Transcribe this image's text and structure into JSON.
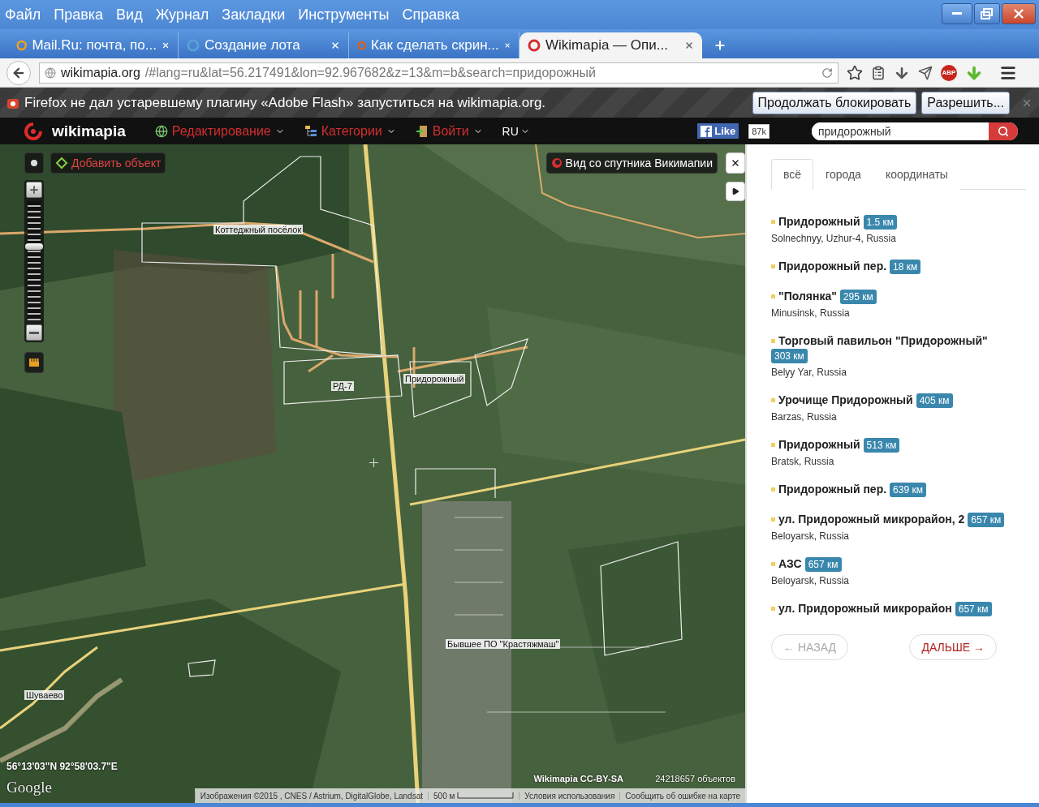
{
  "menu_bar": {
    "items": [
      "Файл",
      "Правка",
      "Вид",
      "Журнал",
      "Закладки",
      "Инструменты",
      "Справка"
    ]
  },
  "tabs": [
    {
      "label": "Mail.Ru: почта, по...",
      "selected": false
    },
    {
      "label": "Создание лота",
      "selected": false
    },
    {
      "label": "Как сделать скрин...",
      "selected": false
    },
    {
      "label": "Wikimapia — Опи...",
      "selected": true
    }
  ],
  "address_bar": {
    "host": "wikimapia.org",
    "path": "/#lang=ru&lat=56.217491&lon=92.967682&z=13&m=b&search=придорожный"
  },
  "toolbar": {
    "adblock_badge": "ABP"
  },
  "notification": {
    "message": "Firefox не дал устаревшему плагину «Adobe Flash» запуститься на wikimapia.org.",
    "buttons": [
      "Продолжать блокировать",
      "Разрешить..."
    ]
  },
  "site_header": {
    "logo": "wikimapia",
    "menu": [
      {
        "label": "Редактирование"
      },
      {
        "label": "Категории"
      },
      {
        "label": "Войти"
      }
    ],
    "language": "RU",
    "like_label": "Like",
    "like_count": "87k",
    "search_value": "придорожный"
  },
  "map": {
    "add_object": "Добавить объект",
    "satellite_view": "Вид со спутника Викимапии",
    "zoom": {
      "level": 0.62
    },
    "labels": [
      "Коттеджный посёлок",
      "РД-7",
      "Придорожный",
      "Бывшее ПО \"Крастяжмаш\"",
      "Шуваево"
    ],
    "coordinates": "56°13'03\"N 92°58'03.7\"E",
    "google": "Google",
    "license": "Wikimapia CC-BY-SA",
    "object_count": "24218657 объектов",
    "attribution": [
      "Изображения ©2015 , CNES / Astrium, DigitalGlobe, Landsat",
      "500 м",
      "Условия использования",
      "Сообщить об ошибке на карте"
    ]
  },
  "results_panel": {
    "tabs": [
      {
        "label": "всё",
        "selected": true
      },
      {
        "label": "города",
        "selected": false
      },
      {
        "label": "координаты",
        "selected": false
      }
    ],
    "results": [
      {
        "name": "Придорожный",
        "distance": "1.5 км",
        "location": "Solnechnyy, Uzhur-4, Russia"
      },
      {
        "name": "Придорожный пер.",
        "distance": "18 км"
      },
      {
        "name": "\"Полянка\"",
        "distance": "295 км",
        "location": "Minusinsk, Russia"
      },
      {
        "name": "Торговый павильон \"Придорожный\"",
        "distance": "303 км",
        "location": "Belyy Yar, Russia"
      },
      {
        "name": "Урочище Придорожный",
        "distance": "405 км",
        "location": "Barzas, Russia"
      },
      {
        "name": "Придорожный",
        "distance": "513 км",
        "location": "Bratsk, Russia"
      },
      {
        "name": "Придорожный пер.",
        "distance": "639 км"
      },
      {
        "name": "ул. Придорожный микрорайон, 2",
        "distance": "657 км",
        "location": "Beloyarsk, Russia"
      },
      {
        "name": "АЗС",
        "distance": "657 км",
        "location": "Beloyarsk, Russia"
      },
      {
        "name": "ул. Придорожный микрорайон",
        "distance": "657 км"
      }
    ],
    "pager": [
      {
        "label": "← НАЗАД",
        "disabled": true
      },
      {
        "label": "ДАЛЬШЕ →",
        "disabled": false
      }
    ]
  }
}
